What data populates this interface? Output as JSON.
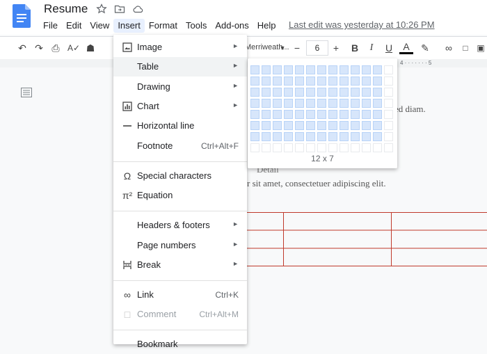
{
  "header": {
    "title": "Resume",
    "menus": [
      "File",
      "Edit",
      "View",
      "Insert",
      "Format",
      "Tools",
      "Add-ons",
      "Help"
    ],
    "active_menu": "Insert",
    "last_edit": "Last edit was yesterday at 10:26 PM"
  },
  "toolbar": {
    "font": "Merriweath...",
    "font_size": "6",
    "icons": [
      "undo-icon",
      "redo-icon",
      "print-icon",
      "spellcheck-icon",
      "paint-format-icon",
      "decrease-size-icon",
      "increase-size-icon",
      "bold-icon",
      "italic-icon",
      "underline-icon",
      "text-color-icon",
      "highlight-icon",
      "link-icon",
      "comment-icon",
      "image-icon"
    ]
  },
  "ruler": "4 · · · · · · · 5",
  "document": {
    "line1": "ed diam.",
    "line2": "Detail",
    "line3": "r sit amet, consectetuer adipiscing elit."
  },
  "insert_menu": {
    "items": [
      {
        "icon": "image-icon",
        "label": "Image",
        "shortcut": "",
        "submenu": true
      },
      {
        "icon": "",
        "label": "Table",
        "shortcut": "",
        "submenu": true
      },
      {
        "icon": "",
        "label": "Drawing",
        "shortcut": "",
        "submenu": true
      },
      {
        "icon": "chart-icon",
        "label": "Chart",
        "shortcut": "",
        "submenu": true
      },
      {
        "icon": "horizontal-line-icon",
        "label": "Horizontal line",
        "shortcut": "",
        "submenu": false
      },
      {
        "icon": "",
        "label": "Footnote",
        "shortcut": "Ctrl+Alt+F",
        "submenu": false
      },
      {
        "icon": "omega-icon",
        "label": "Special characters",
        "shortcut": "",
        "submenu": false
      },
      {
        "icon": "pi-icon",
        "label": "Equation",
        "shortcut": "",
        "submenu": false
      },
      {
        "icon": "",
        "label": "Headers & footers",
        "shortcut": "",
        "submenu": true
      },
      {
        "icon": "",
        "label": "Page numbers",
        "shortcut": "",
        "submenu": true
      },
      {
        "icon": "break-icon",
        "label": "Break",
        "shortcut": "",
        "submenu": true
      },
      {
        "icon": "link-icon",
        "label": "Link",
        "shortcut": "Ctrl+K",
        "submenu": false
      },
      {
        "icon": "comment-icon",
        "label": "Comment",
        "shortcut": "Ctrl+Alt+M",
        "submenu": false,
        "disabled": true
      },
      {
        "icon": "",
        "label": "Bookmark",
        "shortcut": "",
        "submenu": false
      }
    ],
    "highlighted": "Table"
  },
  "table_picker": {
    "selected_cols": 12,
    "selected_rows": 7,
    "label": "12 x 7"
  },
  "colors": {
    "accent": "#1a73e8",
    "doc_table_border": "#c0392b",
    "picker_selected": "#d7e6fb"
  }
}
